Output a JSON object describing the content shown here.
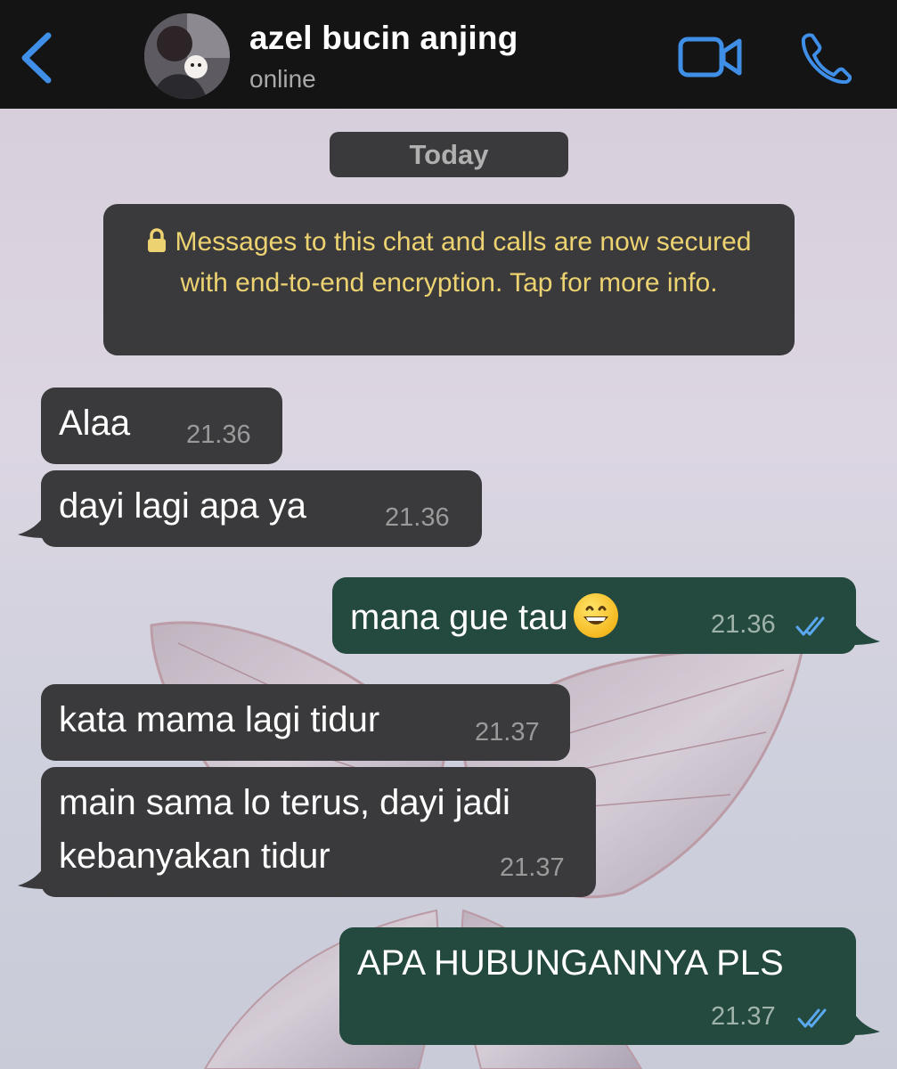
{
  "header": {
    "contact_name": "azel bucin anjing",
    "status": "online",
    "icons": [
      "chevron-left-icon",
      "avatar",
      "video-camera-icon",
      "phone-icon"
    ],
    "accent_color": "#3f8fe8"
  },
  "chat": {
    "date_label": "Today",
    "encryption_notice": "Messages to this chat and calls are now secured with end-to-end encryption. Tap for more info.",
    "messages": [
      {
        "direction": "incoming",
        "text": "Alaa",
        "time": "21.36"
      },
      {
        "direction": "incoming",
        "text": "dayi lagi apa ya",
        "time": "21.36"
      },
      {
        "direction": "outgoing",
        "text": "mana gue tau",
        "emoji": "grinning-face-emoji",
        "time": "21.36",
        "status": "read"
      },
      {
        "direction": "incoming",
        "text": "kata mama lagi tidur",
        "time": "21.37"
      },
      {
        "direction": "incoming",
        "line1": "main sama lo terus, dayi jadi",
        "line2": "kebanyakan tidur",
        "time": "21.37"
      },
      {
        "direction": "outgoing",
        "text": "APA HUBUNGANNYA PLS",
        "time": "21.37",
        "status": "read"
      }
    ]
  },
  "colors": {
    "incoming_bubble": "#3a3a3c",
    "outgoing_bubble": "#24493e",
    "encryption_text": "#ecd270",
    "read_ticks": "#5aa8f0"
  }
}
